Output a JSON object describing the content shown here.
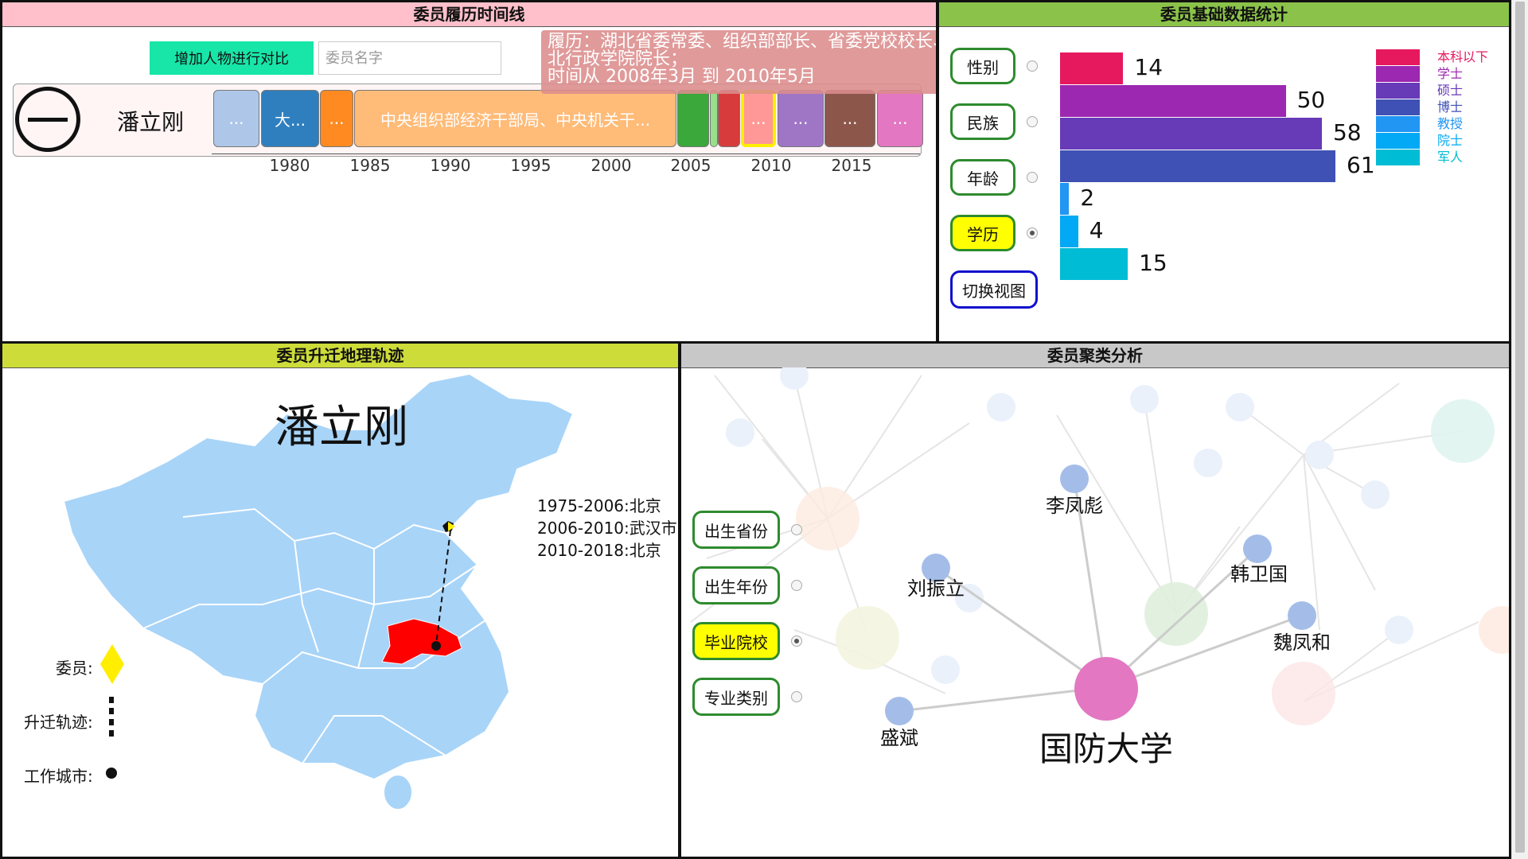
{
  "timeline": {
    "title": "委员履历时间线",
    "add_button": "增加人物进行对比",
    "name_placeholder": "委员名字",
    "person": "潘立刚",
    "segments": [
      {
        "label": "...",
        "color": "#aec7e8"
      },
      {
        "label": "大...",
        "color": "#2f7fbf"
      },
      {
        "label": "...",
        "color": "#ff8a22"
      },
      {
        "label": "中央组织部经济干部局、中央机关干...",
        "color": "#ffbb78"
      },
      {
        "label": "",
        "color": "#3aa83a"
      },
      {
        "label": "",
        "color": "#98df8a"
      },
      {
        "label": "",
        "color": "#d83b3b"
      },
      {
        "label": "...",
        "color": "#ff9896"
      },
      {
        "label": "...",
        "color": "#9f76c6"
      },
      {
        "label": "...",
        "color": "#8c564b"
      },
      {
        "label": "...",
        "color": "#e377c2"
      }
    ],
    "axis_ticks": [
      "1980",
      "1985",
      "1990",
      "1995",
      "2000",
      "2005",
      "2010",
      "2015"
    ],
    "tooltip": {
      "line1": "履历：湖北省委常委、组织部部长、省委党校校长、湖",
      "line2": "北行政学院院长；",
      "line3": "时间从 2008年3月 到 2010年5月"
    }
  },
  "stats": {
    "title": "委员基础数据统计",
    "options": [
      {
        "label": "性别",
        "selected": false
      },
      {
        "label": "民族",
        "selected": false
      },
      {
        "label": "年龄",
        "selected": false
      },
      {
        "label": "学历",
        "selected": true
      }
    ],
    "switch_button": "切换视图",
    "bars": [
      {
        "category": "本科以下",
        "value": 14,
        "color": "#e6195e"
      },
      {
        "category": "学士",
        "value": 50,
        "color": "#9c27b0"
      },
      {
        "category": "硕士",
        "value": 58,
        "color": "#673ab7"
      },
      {
        "category": "博士",
        "value": 61,
        "color": "#3f51b5"
      },
      {
        "category": "教授",
        "value": 2,
        "color": "#2196f3"
      },
      {
        "category": "院士",
        "value": 4,
        "color": "#03a9f4"
      },
      {
        "category": "军人",
        "value": 15,
        "color": "#00bcd4"
      }
    ],
    "legend_colors": [
      "#e6195e",
      "#9c27b0",
      "#673ab7",
      "#3f51b5",
      "#2196f3",
      "#03a9f4",
      "#00bcd4"
    ]
  },
  "map": {
    "title": "委员升迁地理轨迹",
    "person": "潘立刚",
    "track": [
      "1975-2006:北京",
      "2006-2010:武汉市",
      "2010-2018:北京"
    ],
    "legend": {
      "member": "委员:",
      "path": "升迁轨迹:",
      "city": "工作城市:"
    },
    "highlight_color": "#ff0000",
    "map_color": "#a8d4f8"
  },
  "cluster": {
    "title": "委员聚类分析",
    "options": [
      {
        "label": "出生省份",
        "selected": false
      },
      {
        "label": "出生年份",
        "selected": false
      },
      {
        "label": "毕业院校",
        "selected": true
      },
      {
        "label": "专业类别",
        "selected": false
      }
    ],
    "center": "国防大学",
    "members": [
      "李凤彪",
      "刘振立",
      "韩卫国",
      "魏凤和",
      "盛斌"
    ]
  }
}
